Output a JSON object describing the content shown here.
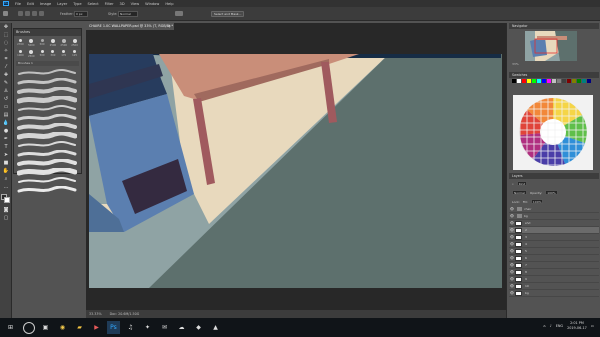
{
  "menu": {
    "logo": "Ps",
    "items": [
      "File",
      "Edit",
      "Image",
      "Layer",
      "Type",
      "Select",
      "Filter",
      "3D",
      "View",
      "Window",
      "Help"
    ]
  },
  "options": {
    "feather_label": "Feather:",
    "feather_value": "0 px",
    "style_label": "Style:",
    "style_value": "Normal",
    "select_mask_label": "Select and Mask..."
  },
  "document": {
    "tab_title": "CHAIRE 1.0C WALLPAPER.psd @ 33% (T, RGB/8) *",
    "close": "×"
  },
  "status": {
    "zoom": "33.33%",
    "doc_info": "Doc: 20.6M/1.50G"
  },
  "brushes": {
    "title": "Brushes",
    "sizes": [
      "2700",
      "5000",
      "500",
      "2500",
      "2500",
      "2500"
    ],
    "sizes2": [
      "1000",
      "2500",
      "500",
      "300",
      "170",
      "125"
    ],
    "set_name": "Brushes 1",
    "strokes": 14
  },
  "navigator": {
    "title": "Navigator",
    "zoom": "33%"
  },
  "swatches": {
    "title": "Swatches",
    "colors": [
      "#000000",
      "#ffffff",
      "#ff0000",
      "#ffff00",
      "#00ff00",
      "#00ffff",
      "#0000ff",
      "#ff00ff",
      "#c0c0c0",
      "#808080",
      "#404040",
      "#800000",
      "#808000",
      "#008000",
      "#008080",
      "#000080"
    ]
  },
  "layers": {
    "title": "Layers",
    "kind_label": "Kind",
    "blend_mode": "Normal",
    "opacity_label": "Opacity:",
    "opacity_value": "100%",
    "fill_label": "Fill:",
    "fill_value": "100%",
    "lock_label": "Lock:",
    "items": [
      {
        "name": "chair",
        "type": "folder",
        "selected": false
      },
      {
        "name": "bg",
        "type": "folder",
        "selected": false
      },
      {
        "name": "shd",
        "type": "layer",
        "selected": false
      },
      {
        "name": "2",
        "type": "layer",
        "selected": true
      },
      {
        "name": "3",
        "type": "layer",
        "selected": false
      },
      {
        "name": "4",
        "type": "layer",
        "selected": false
      },
      {
        "name": "5",
        "type": "layer",
        "selected": false
      },
      {
        "name": "6",
        "type": "layer",
        "selected": false
      },
      {
        "name": "7",
        "type": "layer",
        "selected": false
      },
      {
        "name": "8",
        "type": "layer",
        "selected": false
      },
      {
        "name": "9",
        "type": "layer",
        "selected": false
      },
      {
        "name": "10",
        "type": "layer",
        "selected": false
      },
      {
        "name": "bg",
        "type": "layer",
        "selected": false
      }
    ]
  },
  "tray": {
    "time": "2:01 PM",
    "date": "2019-06-17",
    "lang": "ENG"
  },
  "colors": {
    "accent": "#31a8ff",
    "ui_dark": "#323232",
    "ui_mid": "#535353",
    "canvas_wall": "#e8d9bd",
    "canvas_floor": "#5d706d",
    "chair_blue": "#5b7fb0"
  }
}
